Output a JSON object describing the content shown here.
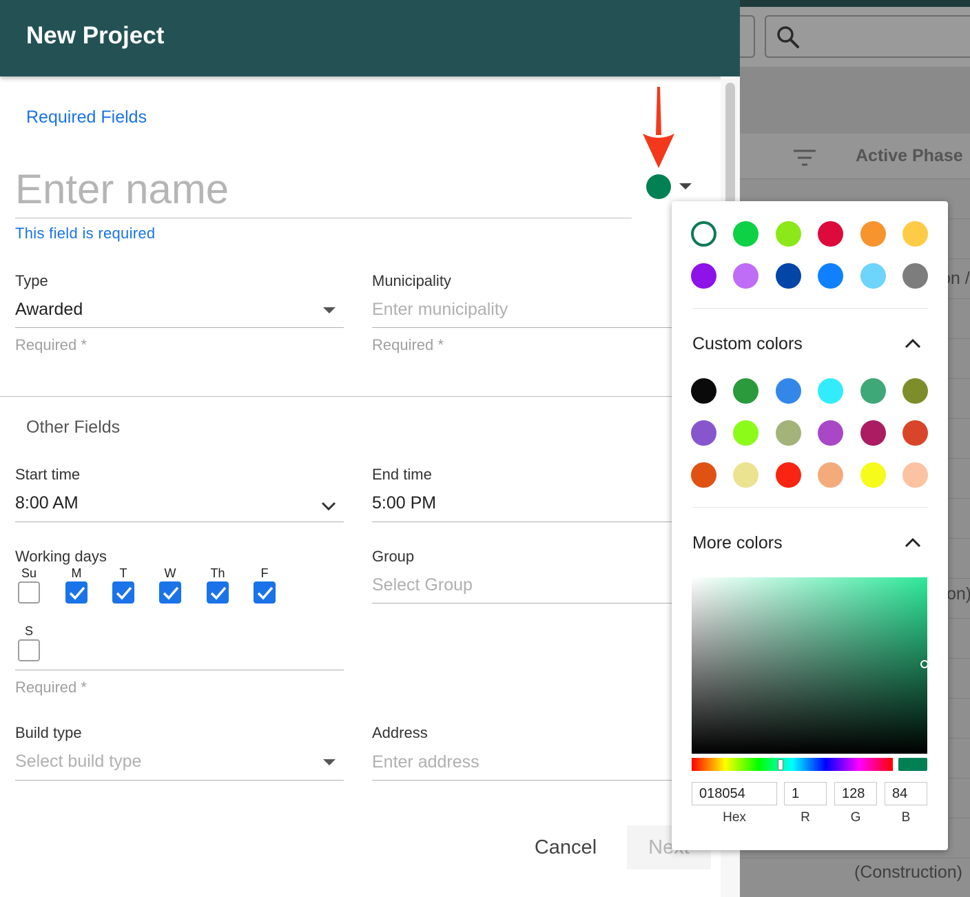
{
  "dialog": {
    "title": "New Project",
    "required_section": "Required Fields",
    "name_placeholder": "Enter name",
    "name_error": "This field is required",
    "selected_color": "#018054",
    "type": {
      "label": "Type",
      "value": "Awarded",
      "helper": "Required *"
    },
    "municipality": {
      "label": "Municipality",
      "placeholder": "Enter municipality",
      "helper": "Required *"
    },
    "other_section": "Other Fields",
    "start_time": {
      "label": "Start time",
      "value": "8:00 AM"
    },
    "end_time": {
      "label": "End time",
      "value": "5:00 PM"
    },
    "working_days": {
      "label": "Working days",
      "helper": "Required *",
      "days": [
        {
          "label": "Su",
          "checked": false
        },
        {
          "label": "M",
          "checked": true
        },
        {
          "label": "T",
          "checked": true
        },
        {
          "label": "W",
          "checked": true
        },
        {
          "label": "Th",
          "checked": true
        },
        {
          "label": "F",
          "checked": true
        },
        {
          "label": "S",
          "checked": false
        }
      ]
    },
    "group": {
      "label": "Group",
      "placeholder": "Select Group"
    },
    "build_type": {
      "label": "Build type",
      "placeholder": "Select build type"
    },
    "address": {
      "label": "Address",
      "placeholder": "Enter address"
    },
    "cancel_label": "Cancel",
    "next_label": "Next"
  },
  "color_picker": {
    "preset_colors": [
      "#ffffff",
      "#0ed145",
      "#8de81a",
      "#dc0b3c",
      "#f7942e",
      "#fdcb45",
      "#8d13e8",
      "#bf6cf7",
      "#0445a8",
      "#1180ff",
      "#6dd4fb",
      "#7d7d7d"
    ],
    "custom_colors_title": "Custom colors",
    "custom_colors": [
      "#0a0a0a",
      "#2a9a3c",
      "#3387e8",
      "#33ecfb",
      "#3ea878",
      "#7c8d2a",
      "#8756cd",
      "#8dfb1a",
      "#a3b37a",
      "#a848c6",
      "#ab1c63",
      "#d8452a",
      "#e05214",
      "#ece391",
      "#fa2412",
      "#f3ab7c",
      "#f7fb1c",
      "#fbc3a2"
    ],
    "more_colors_title": "More colors",
    "hex": "018054",
    "r": "1",
    "g": "128",
    "b": "84",
    "hex_label": "Hex",
    "r_label": "R",
    "g_label": "G",
    "b_label": "B"
  },
  "background": {
    "column_title": "Active Phase",
    "row_fragments": [
      "on /",
      "on)",
      "(Construction)"
    ]
  }
}
